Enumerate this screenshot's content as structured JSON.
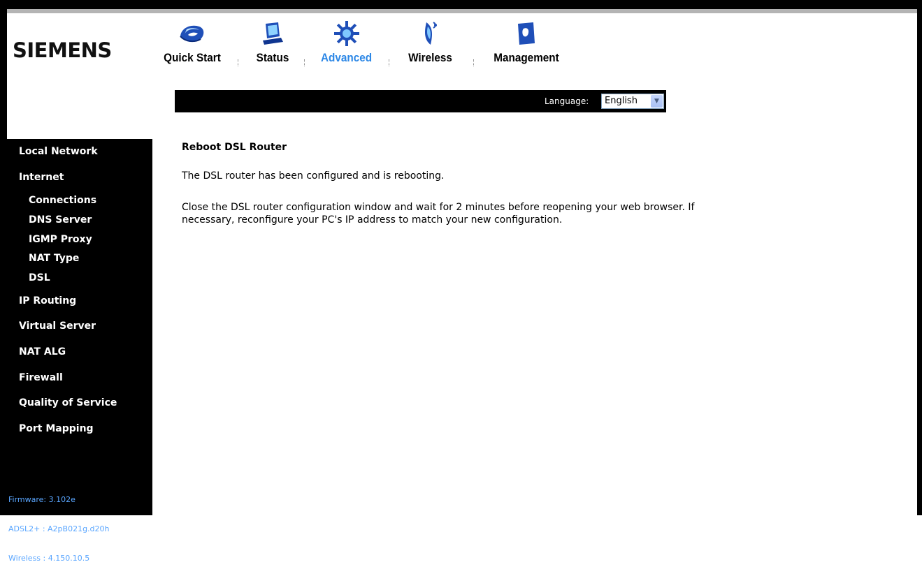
{
  "brand": {
    "logo_text": "SIEMENS"
  },
  "nav": {
    "items": [
      {
        "label": "Quick Start",
        "icon": "mouse-icon",
        "active": false
      },
      {
        "label": "Status",
        "icon": "monitor-icon",
        "active": false
      },
      {
        "label": "Advanced",
        "icon": "chip-icon",
        "active": true
      },
      {
        "label": "Wireless",
        "icon": "wireless-signal-icon",
        "active": false
      },
      {
        "label": "Management",
        "icon": "book-icon",
        "active": false
      }
    ],
    "active_color": "#2c87e6"
  },
  "language": {
    "label": "Language:",
    "value": "English"
  },
  "sidebar": {
    "items": [
      {
        "label": "Local Network"
      },
      {
        "label": "Internet"
      },
      {
        "label": "Connections"
      },
      {
        "label": "DNS Server"
      },
      {
        "label": "IGMP Proxy"
      },
      {
        "label": "NAT Type"
      },
      {
        "label": "DSL"
      },
      {
        "label": "IP Routing"
      },
      {
        "label": "Virtual Server"
      },
      {
        "label": "NAT ALG"
      },
      {
        "label": "Firewall"
      },
      {
        "label": "Quality of Service"
      },
      {
        "label": "Port Mapping"
      }
    ],
    "firmware_lines": [
      "Firmware: 3.102e",
      "ADSL2+ : A2pB021g.d20h",
      "Wireless : 4.150.10.5"
    ]
  },
  "content": {
    "title": "Reboot DSL Router",
    "paragraph1": "The DSL router has been configured and is rebooting.",
    "paragraph2": "Close the DSL router configuration window and wait for 2 minutes before reopening your web browser. If necessary, reconfigure your PC's IP address to match your new configuration."
  }
}
